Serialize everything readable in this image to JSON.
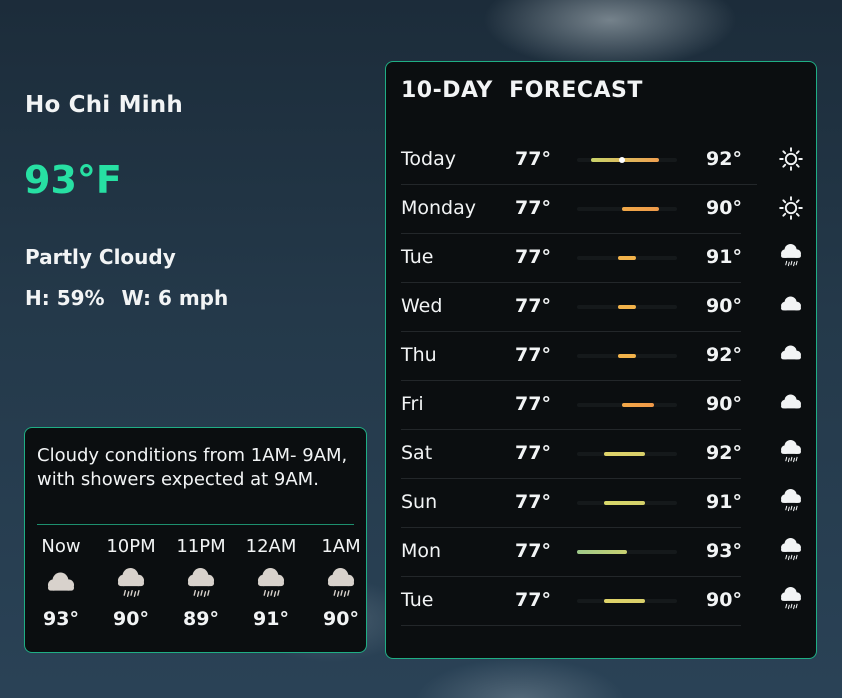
{
  "current": {
    "city": "Ho Chi Minh",
    "temperature": "93°F",
    "condition": "Partly Cloudy",
    "humidity": "H: 59%",
    "wind": "W: 6 mph"
  },
  "hourly": {
    "summary": "Cloudy conditions from 1AM- 9AM, with showers expected at 9AM.",
    "hours": [
      {
        "time": "Now",
        "temp": "93°",
        "icon": "cloud-icon"
      },
      {
        "time": "10PM",
        "temp": "90°",
        "icon": "cloud-rain-icon"
      },
      {
        "time": "11PM",
        "temp": "89°",
        "icon": "cloud-rain-icon"
      },
      {
        "time": "12AM",
        "temp": "91°",
        "icon": "cloud-rain-icon"
      },
      {
        "time": "1AM",
        "temp": "90°",
        "icon": "cloud-rain-icon"
      }
    ]
  },
  "forecast": {
    "title": "10-DAY  FORECAST",
    "range_scale": [
      74,
      96
    ],
    "days": [
      {
        "day": "Today",
        "low": "77°",
        "high": "92°",
        "low_value": 77,
        "high_value": 92,
        "icon": "sun-icon",
        "current_value": 84,
        "color_from": "#c9d36a",
        "color_to": "#f0a050"
      },
      {
        "day": "Monday",
        "low": "77°",
        "high": "90°",
        "low_value": 84,
        "high_value": 92,
        "icon": "sun-icon",
        "color_from": "#f0a848",
        "color_to": "#ee9a4a"
      },
      {
        "day": "Tue",
        "low": "77°",
        "high": "91°",
        "low_value": 83,
        "high_value": 87,
        "icon": "cloud-rain-icon",
        "color_from": "#f2b24a",
        "color_to": "#f2b24a"
      },
      {
        "day": "Wed",
        "low": "77°",
        "high": "90°",
        "low_value": 83,
        "high_value": 87,
        "icon": "cloud-icon",
        "color_from": "#f2b24a",
        "color_to": "#f2b24a"
      },
      {
        "day": "Thu",
        "low": "77°",
        "high": "92°",
        "low_value": 83,
        "high_value": 87,
        "icon": "cloud-icon",
        "color_from": "#f2b24a",
        "color_to": "#f2b24a"
      },
      {
        "day": "Fri",
        "low": "77°",
        "high": "90°",
        "low_value": 84,
        "high_value": 91,
        "icon": "cloud-icon",
        "color_from": "#f2a848",
        "color_to": "#f09848"
      },
      {
        "day": "Sat",
        "low": "77°",
        "high": "92°",
        "low_value": 80,
        "high_value": 89,
        "icon": "cloud-rain-icon",
        "color_from": "#e0d46a",
        "color_to": "#d8cf6a"
      },
      {
        "day": "Sun",
        "low": "77°",
        "high": "91°",
        "low_value": 80,
        "high_value": 89,
        "icon": "cloud-rain-icon",
        "color_from": "#d8d86a",
        "color_to": "#d4d06a"
      },
      {
        "day": "Mon",
        "low": "77°",
        "high": "93°",
        "low_value": 74,
        "high_value": 85,
        "icon": "cloud-rain-icon",
        "color_from": "#9ec98a",
        "color_to": "#c8d070"
      },
      {
        "day": "Tue",
        "low": "77°",
        "high": "90°",
        "low_value": 80,
        "high_value": 89,
        "icon": "cloud-rain-icon",
        "color_from": "#e0d46a",
        "color_to": "#d8cf6a"
      }
    ]
  },
  "colors": {
    "accent": "#27e0a3",
    "panel_border": "#1fae84",
    "panel_bg": "#0b0e10"
  }
}
